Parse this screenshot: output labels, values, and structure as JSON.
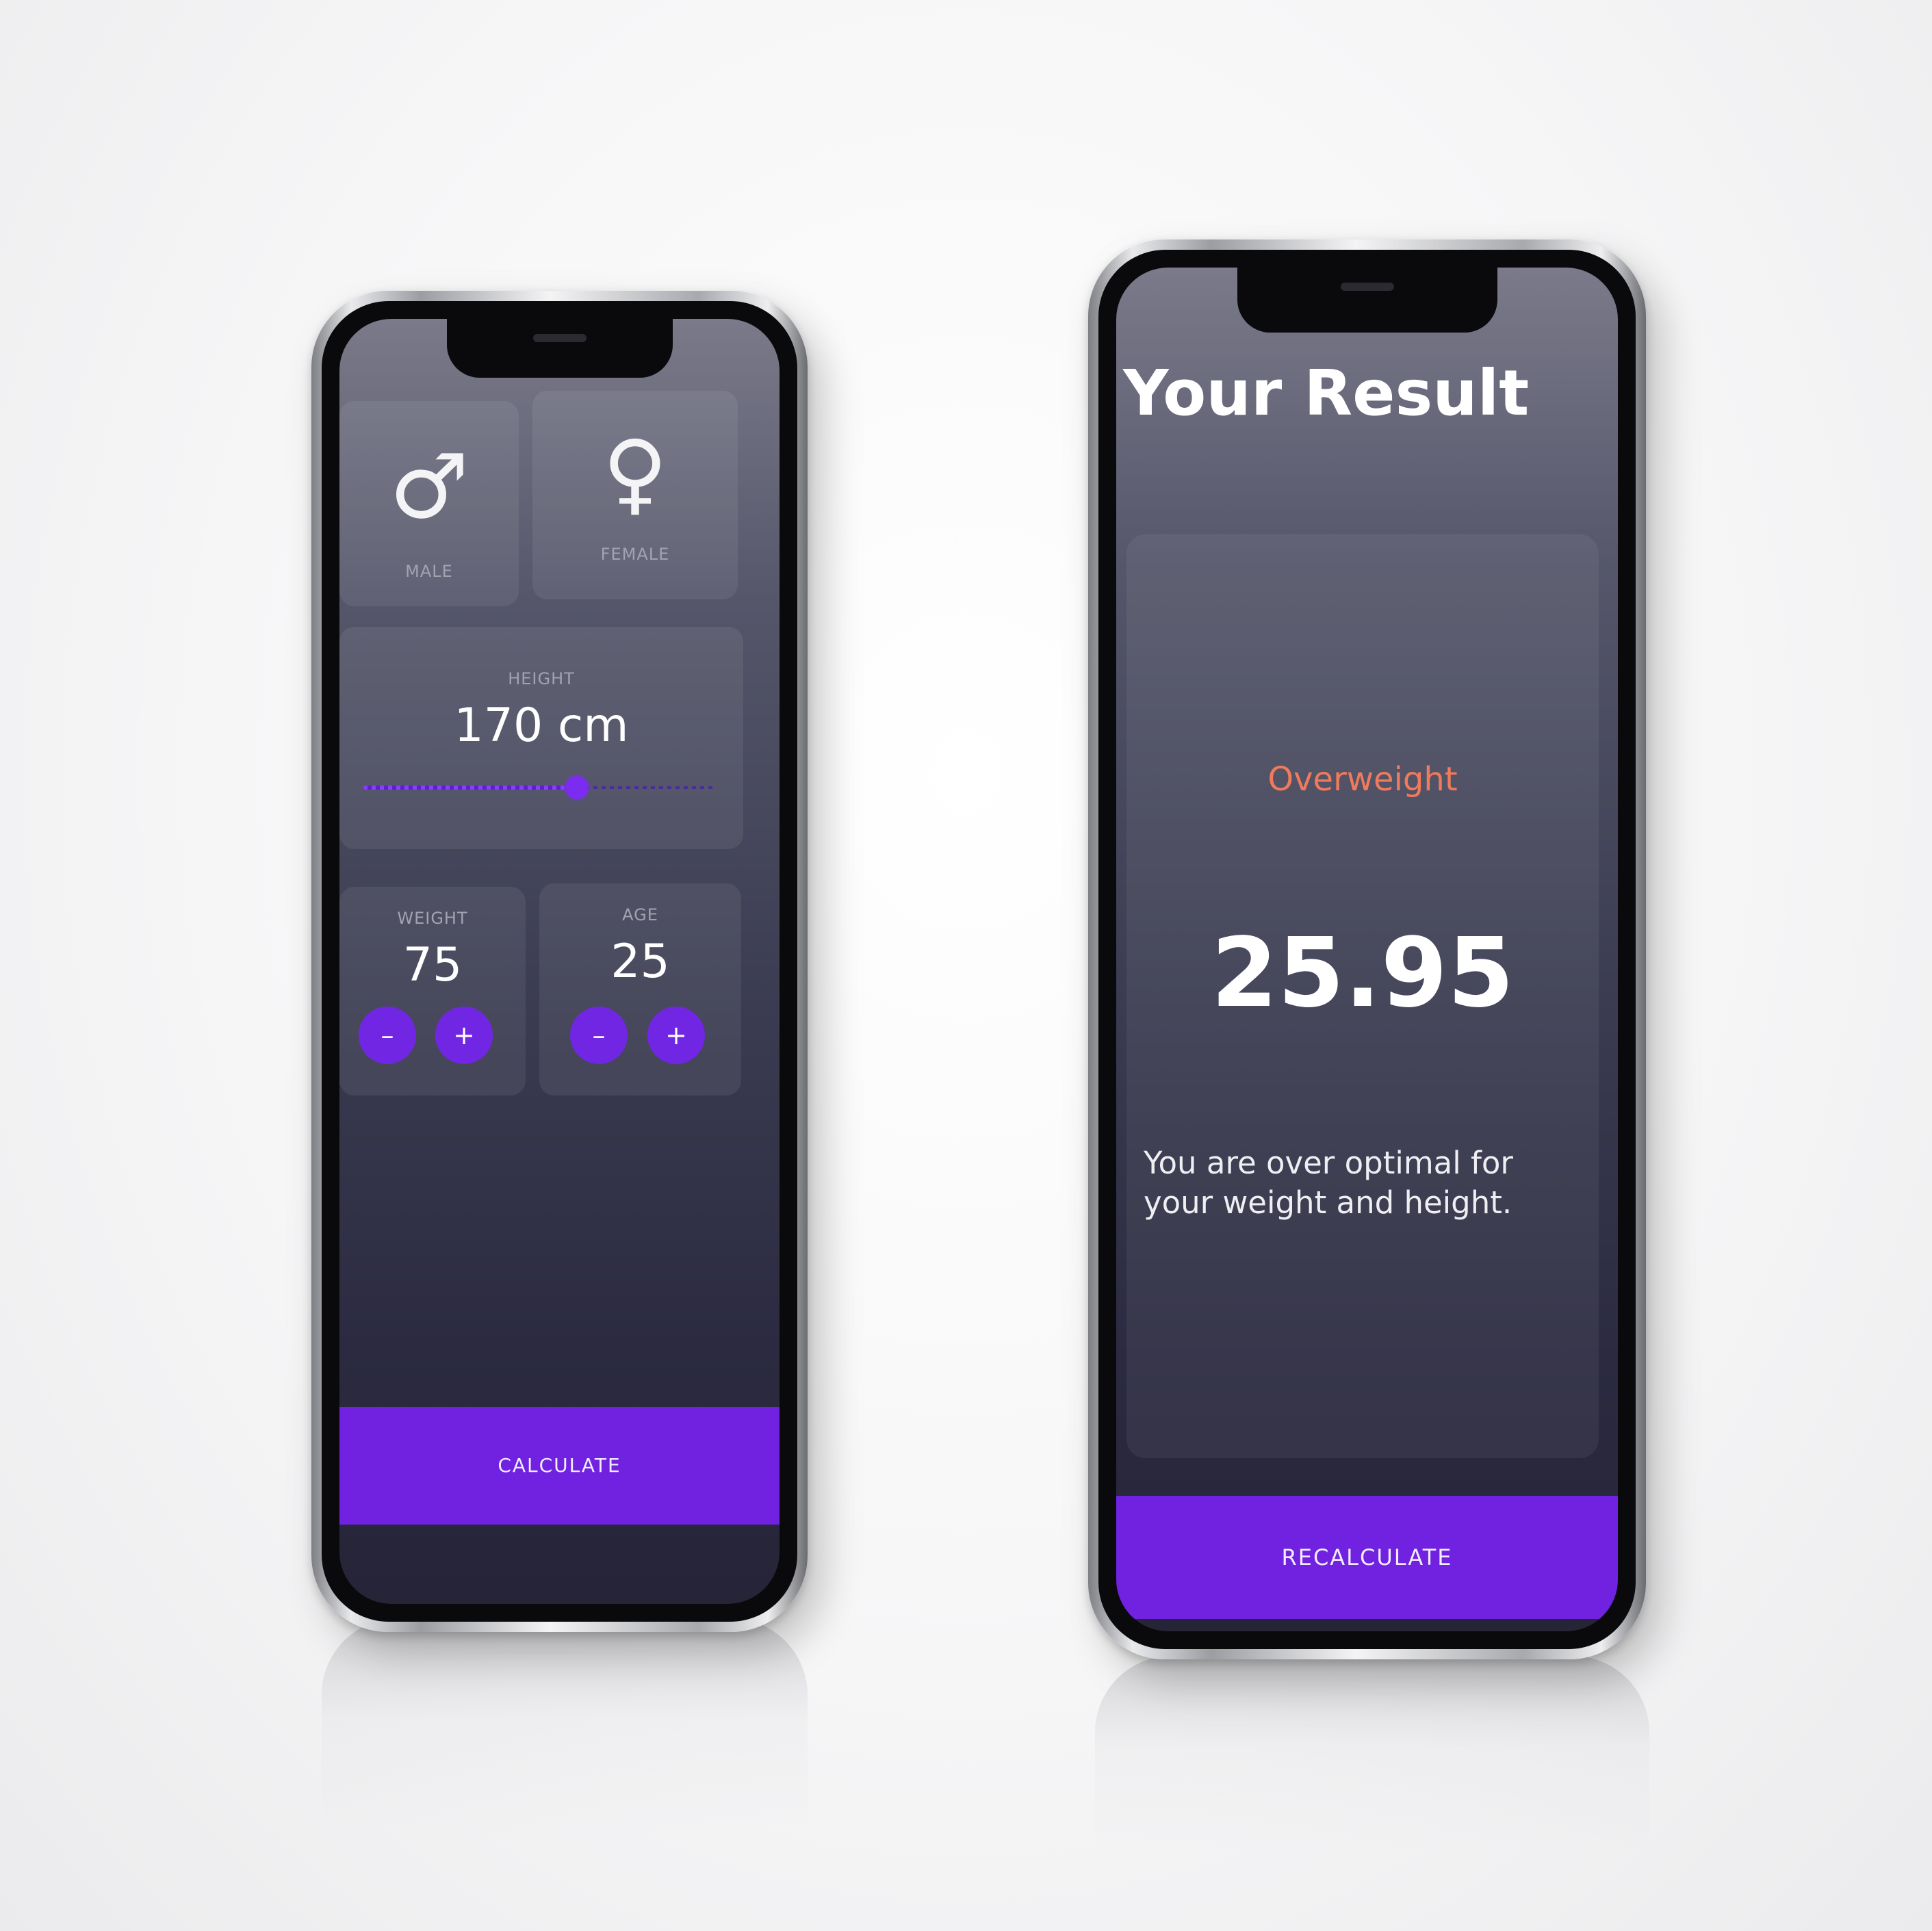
{
  "left_phone": {
    "gender": {
      "male": {
        "symbol": "♂",
        "label": "MALE"
      },
      "female": {
        "symbol": "♀",
        "label": "FEMALE"
      }
    },
    "height": {
      "label": "HEIGHT",
      "value": "170 cm",
      "slider_fraction": 0.61
    },
    "weight": {
      "label": "WEIGHT",
      "value": "75",
      "minus": "–",
      "plus": "+"
    },
    "age": {
      "label": "AGE",
      "value": "25",
      "minus": "–",
      "plus": "+"
    },
    "calculate_label": "CALCULATE"
  },
  "right_phone": {
    "title": "Your Result",
    "status": "Overweight",
    "bmi": "25.95",
    "advice": "You are over optimal for your weight and height.",
    "recalculate_label": "RECALCULATE"
  },
  "colors": {
    "accent": "#7022e0",
    "status": "#f07a5c",
    "background_top": "#7a7a8a",
    "background_bottom": "#262437"
  }
}
